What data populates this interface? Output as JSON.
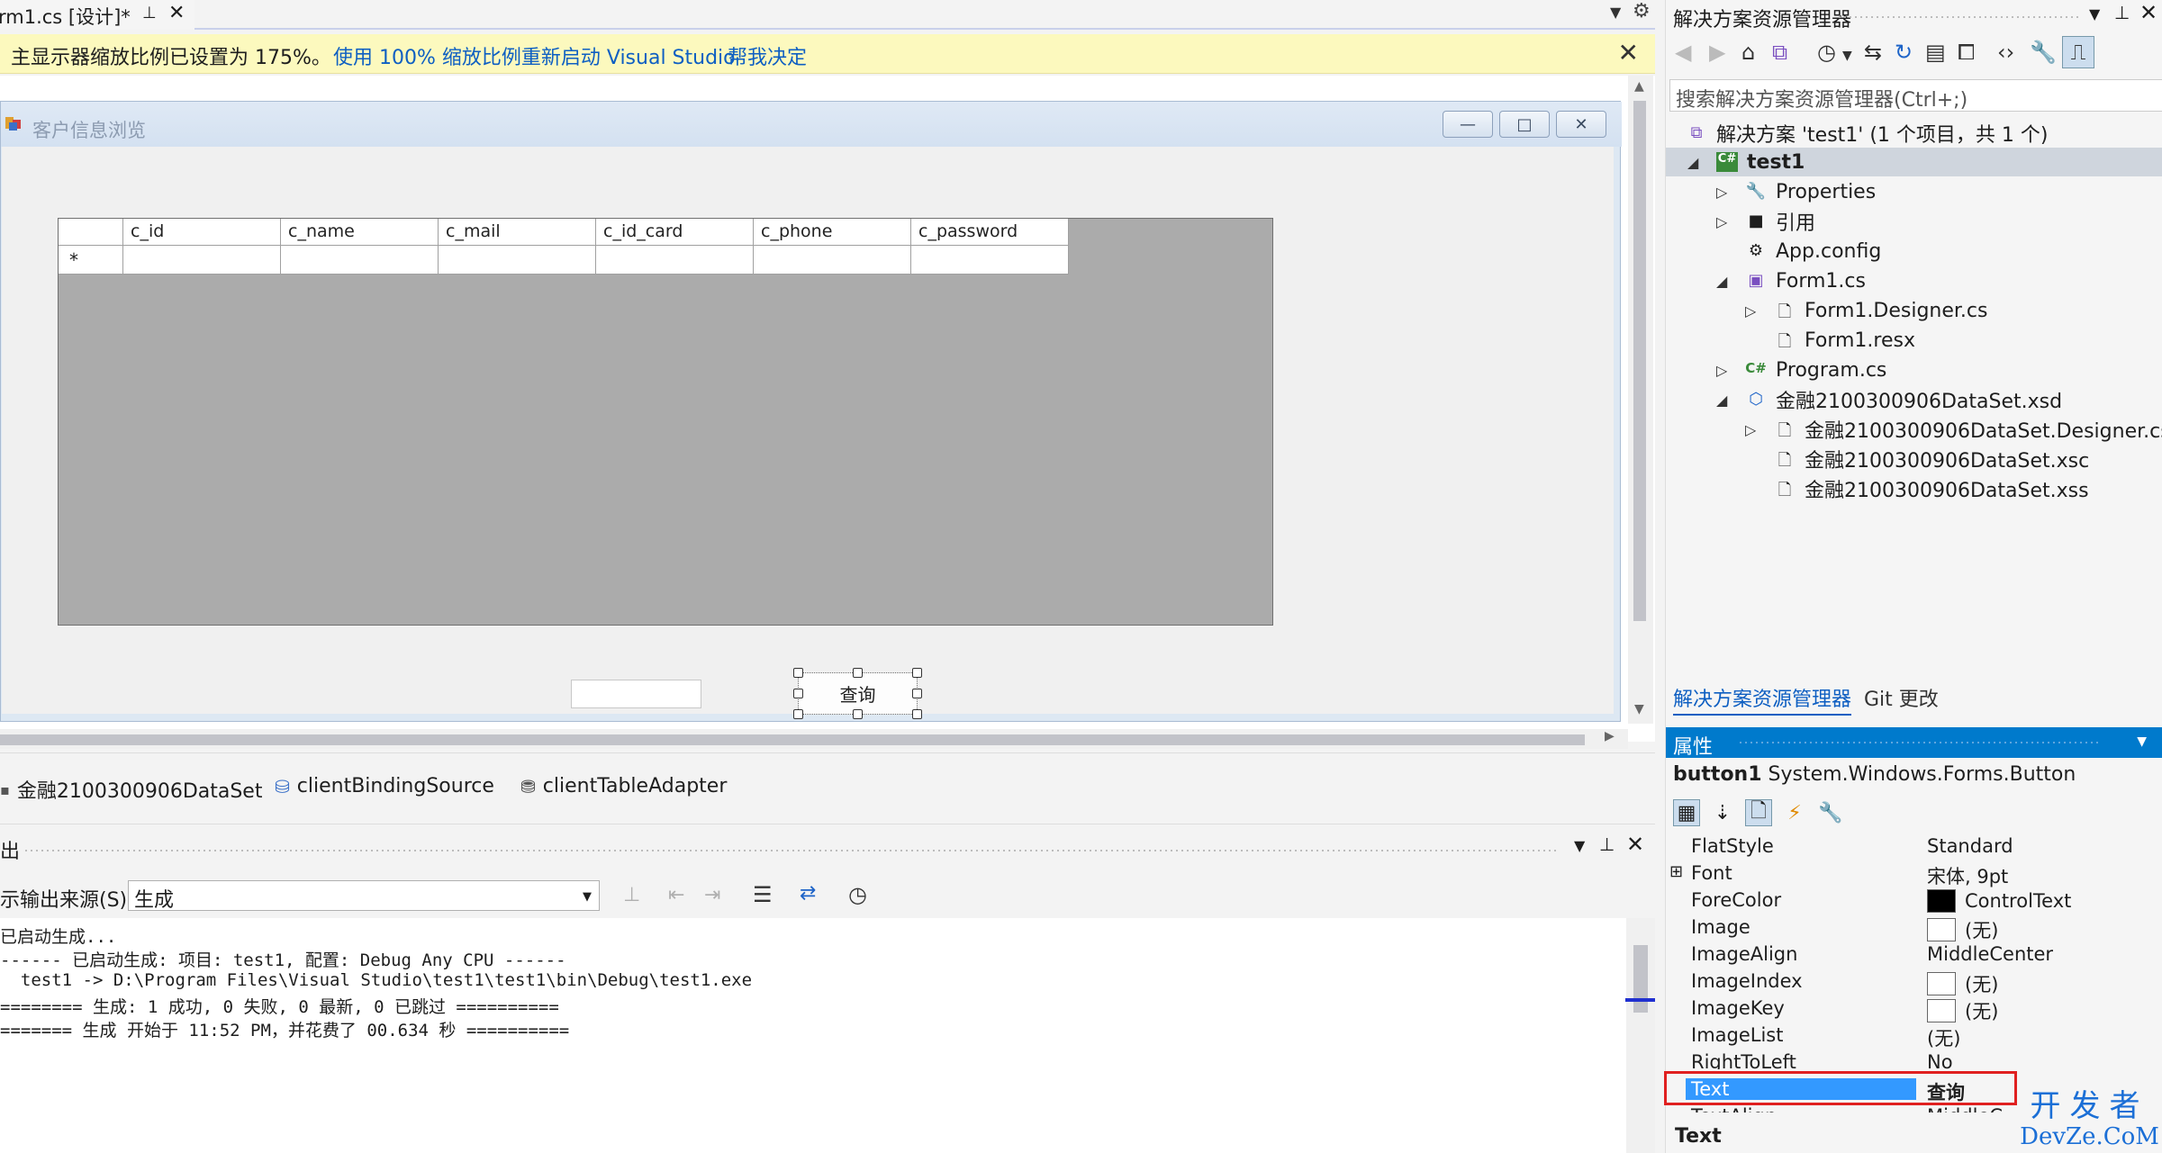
{
  "doc_tab": {
    "title": "rm1.cs [设计]*",
    "pin": "⊥",
    "close": "✕"
  },
  "infobar": {
    "message": "主显示器缩放比例已设置为 175%。",
    "link1": "使用 100% 缩放比例重新启动 Visual Studio",
    "link2": "帮我决定",
    "close": "✕"
  },
  "form": {
    "title": "客户信息浏览",
    "minimize": "—",
    "maximize": "□",
    "close": "✕",
    "grid_columns": [
      "c_id",
      "c_name",
      "c_mail",
      "c_id_card",
      "c_phone",
      "c_password"
    ],
    "new_row_marker": "*",
    "button_label": "查询"
  },
  "tray": {
    "items": [
      "金融2100300906DataSet",
      "clientBindingSource",
      "clientTableAdapter"
    ]
  },
  "output": {
    "title": "出",
    "source_label": "示输出来源(S):",
    "source_value": "生成",
    "lines": [
      "已启动生成...",
      "------ 已启动生成: 项目: test1, 配置: Debug Any CPU ------",
      "  test1 -> D:\\Program Files\\Visual Studio\\test1\\test1\\bin\\Debug\\test1.exe",
      "======== 生成: 1 成功, 0 失败, 0 最新, 0 已跳过 ==========",
      "======= 生成 开始于 11:52 PM，并花费了 00.634 秒 =========="
    ]
  },
  "solution_explorer": {
    "title": "解决方案资源管理器",
    "search_placeholder": "搜索解决方案资源管理器(Ctrl+;)",
    "nodes": [
      {
        "label": "解决方案 'test1' (1 个项目，共 1 个)",
        "icon": "solution-icon"
      },
      {
        "label": "test1",
        "icon": "csproj-icon"
      },
      {
        "label": "Properties",
        "icon": "wrench-icon"
      },
      {
        "label": "引用",
        "icon": "references-icon"
      },
      {
        "label": "App.config",
        "icon": "config-icon"
      },
      {
        "label": "Form1.cs",
        "icon": "form-icon"
      },
      {
        "label": "Form1.Designer.cs",
        "icon": "file-icon"
      },
      {
        "label": "Form1.resx",
        "icon": "file-icon"
      },
      {
        "label": "Program.cs",
        "icon": "csharp-icon"
      },
      {
        "label": "金融2100300906DataSet.xsd",
        "icon": "dataset-icon"
      },
      {
        "label": "金融2100300906DataSet.Designer.cs",
        "icon": "file-icon"
      },
      {
        "label": "金融2100300906DataSet.xsc",
        "icon": "file-icon"
      },
      {
        "label": "金融2100300906DataSet.xss",
        "icon": "file-icon"
      }
    ],
    "tab1": "解决方案资源管理器",
    "tab2": "Git 更改"
  },
  "properties": {
    "title": "属性",
    "object_name": "button1",
    "object_type": "System.Windows.Forms.Button",
    "rows": [
      {
        "name": "FlatStyle",
        "value": "Standard"
      },
      {
        "name": "Font",
        "value": "宋体, 9pt"
      },
      {
        "name": "ForeColor",
        "value": "ControlText"
      },
      {
        "name": "Image",
        "value": "(无)"
      },
      {
        "name": "ImageAlign",
        "value": "MiddleCenter"
      },
      {
        "name": "ImageIndex",
        "value": "(无)"
      },
      {
        "name": "ImageKey",
        "value": "(无)"
      },
      {
        "name": "ImageList",
        "value": "(无)"
      },
      {
        "name": "RightToLeft",
        "value": "No"
      },
      {
        "name": "Text",
        "value": "查询"
      },
      {
        "name": "TextAlign",
        "value": "MiddleC"
      }
    ],
    "description_title": "Text"
  },
  "watermark": {
    "line1": "开发者",
    "line2": "DevZe.CoM"
  },
  "colors": {
    "accent": "#007acc",
    "infobar": "#fcf9be",
    "link": "#0e5fc2",
    "selection": "#3399ff",
    "highlight_box": "#e02020"
  }
}
